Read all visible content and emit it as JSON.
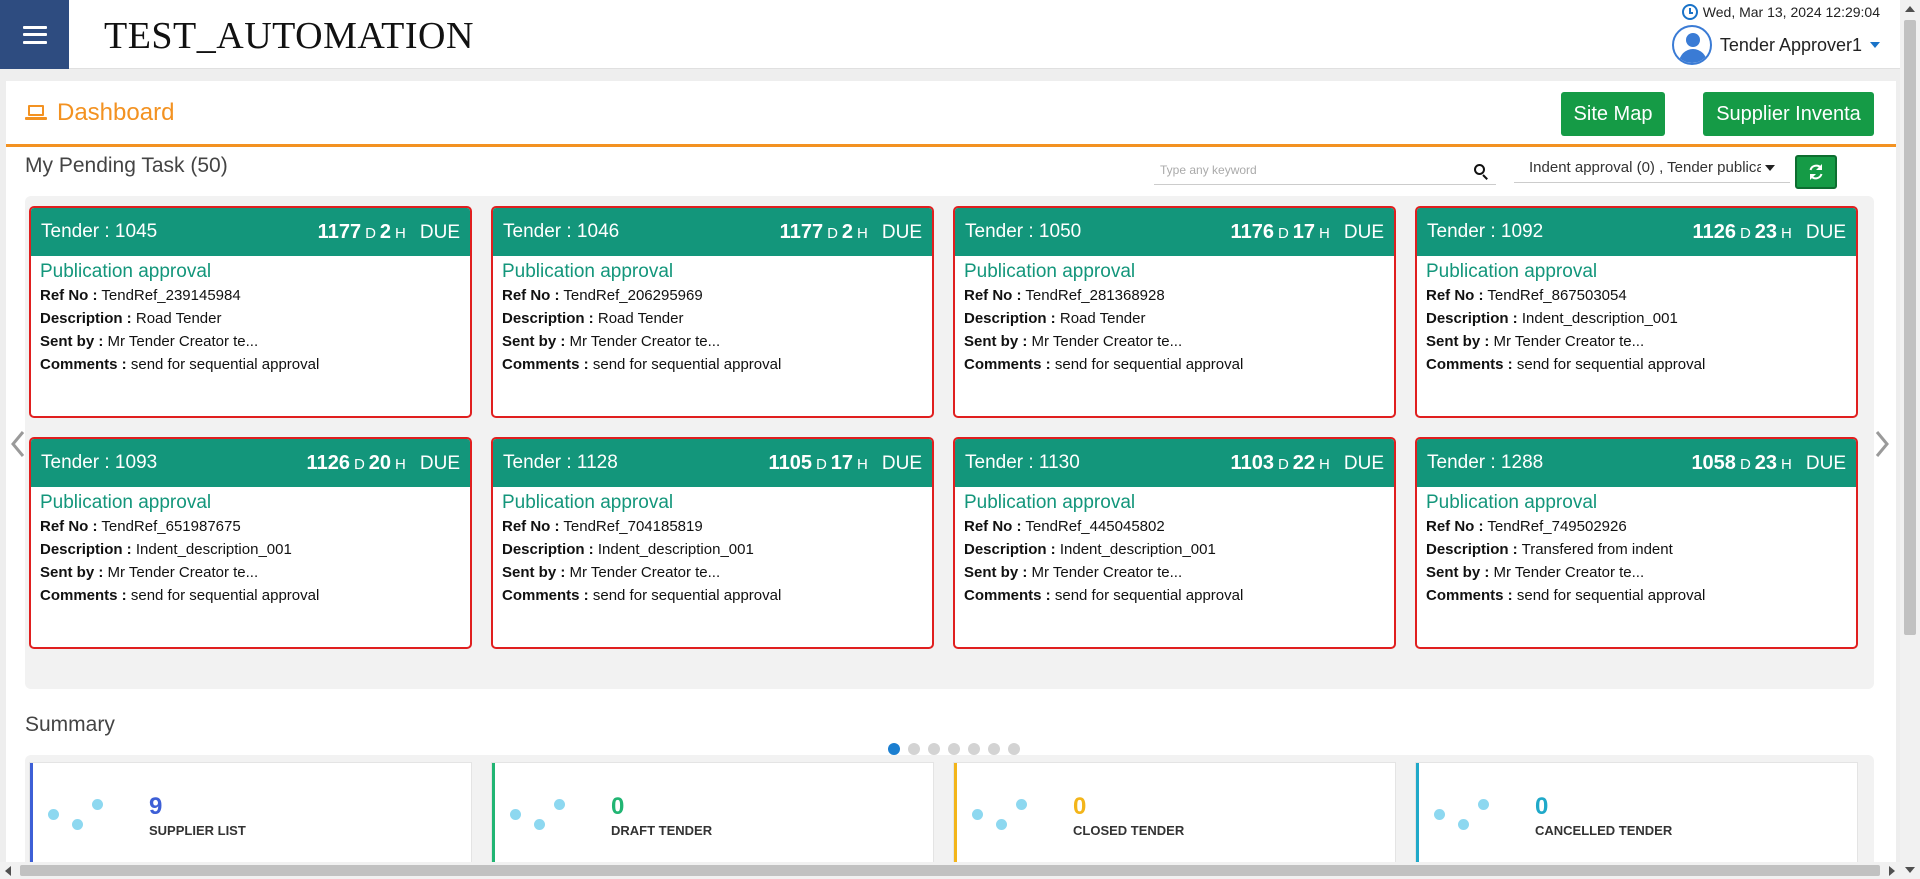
{
  "header": {
    "app_title": "TEST_AUTOMATION",
    "datetime": "Wed, Mar 13, 2024 12:29:04",
    "user_name": "Tender Approver1"
  },
  "dashboard": {
    "title": "Dashboard",
    "site_map_label": "Site Map",
    "supplier_label": "Supplier Inventa"
  },
  "pending": {
    "title": "My Pending Task (50)",
    "search_placeholder": "Type any keyword",
    "filter_value": "Indent approval (0)  , Tender publica"
  },
  "tasks": [
    {
      "tender": "Tender : 1045",
      "days": "1177",
      "hours": "2",
      "d_unit": "D",
      "h_unit": "H",
      "due": "DUE",
      "status": "Publication approval",
      "ref": "TendRef_239145984",
      "desc": "Road Tender",
      "sent": "Mr Tender Creator te...",
      "comments": "send for sequential approval"
    },
    {
      "tender": "Tender : 1046",
      "days": "1177",
      "hours": "2",
      "d_unit": "D",
      "h_unit": "H",
      "due": "DUE",
      "status": "Publication approval",
      "ref": "TendRef_206295969",
      "desc": "Road Tender",
      "sent": "Mr Tender Creator te...",
      "comments": "send for sequential approval"
    },
    {
      "tender": "Tender : 1050",
      "days": "1176",
      "hours": "17",
      "d_unit": "D",
      "h_unit": "H",
      "due": "DUE",
      "status": "Publication approval",
      "ref": "TendRef_281368928",
      "desc": "Road Tender",
      "sent": "Mr Tender Creator te...",
      "comments": "send for sequential approval"
    },
    {
      "tender": "Tender : 1092",
      "days": "1126",
      "hours": "23",
      "d_unit": "D",
      "h_unit": "H",
      "due": "DUE",
      "status": "Publication approval",
      "ref": "TendRef_867503054",
      "desc": "Indent_description_001",
      "sent": "Mr Tender Creator te...",
      "comments": "send for sequential approval"
    },
    {
      "tender": "Tender : 1093",
      "days": "1126",
      "hours": "20",
      "d_unit": "D",
      "h_unit": "H",
      "due": "DUE",
      "status": "Publication approval",
      "ref": "TendRef_651987675",
      "desc": "Indent_description_001",
      "sent": "Mr Tender Creator te...",
      "comments": "send for sequential approval"
    },
    {
      "tender": "Tender : 1128",
      "days": "1105",
      "hours": "17",
      "d_unit": "D",
      "h_unit": "H",
      "due": "DUE",
      "status": "Publication approval",
      "ref": "TendRef_704185819",
      "desc": "Indent_description_001",
      "sent": "Mr Tender Creator te...",
      "comments": "send for sequential approval"
    },
    {
      "tender": "Tender : 1130",
      "days": "1103",
      "hours": "22",
      "d_unit": "D",
      "h_unit": "H",
      "due": "DUE",
      "status": "Publication approval",
      "ref": "TendRef_445045802",
      "desc": "Indent_description_001",
      "sent": "Mr Tender Creator te...",
      "comments": "send for sequential approval"
    },
    {
      "tender": "Tender : 1288",
      "days": "1058",
      "hours": "23",
      "d_unit": "D",
      "h_unit": "H",
      "due": "DUE",
      "status": "Publication approval",
      "ref": "TendRef_749502926",
      "desc": "Transfered from indent",
      "sent": "Mr Tender Creator te...",
      "comments": "send for sequential approval"
    }
  ],
  "field_labels": {
    "ref": "Ref No :",
    "desc": "Description :",
    "sent": "Sent by :",
    "comments": "Comments :"
  },
  "summary": {
    "title": "Summary",
    "cards": [
      {
        "count": "9",
        "label": "SUPPLIER LIST",
        "color": "#3d5fd6"
      },
      {
        "count": "0",
        "label": "DRAFT TENDER",
        "color": "#21b573"
      },
      {
        "count": "0",
        "label": "CLOSED TENDER",
        "color": "#f3b51a"
      },
      {
        "count": "0",
        "label": "CANCELLED TENDER",
        "color": "#20a9c9"
      }
    ]
  },
  "colors": {
    "brand_dark": "#2e4c80",
    "accent_orange": "#f39221",
    "card_teal": "#13967b",
    "button_green": "#159b46",
    "card_border_red": "#e01f1f",
    "dot_active": "#1a7ed0"
  },
  "icons": {
    "menu": "hamburger-icon",
    "clock": "clock-icon",
    "user": "user-avatar-icon",
    "dashboard": "laptop-icon",
    "search": "search-icon",
    "refresh": "refresh-icon",
    "prev": "chevron-left-icon",
    "next": "chevron-right-icon"
  },
  "carousel": {
    "page_count": 7,
    "active_page": 1
  }
}
